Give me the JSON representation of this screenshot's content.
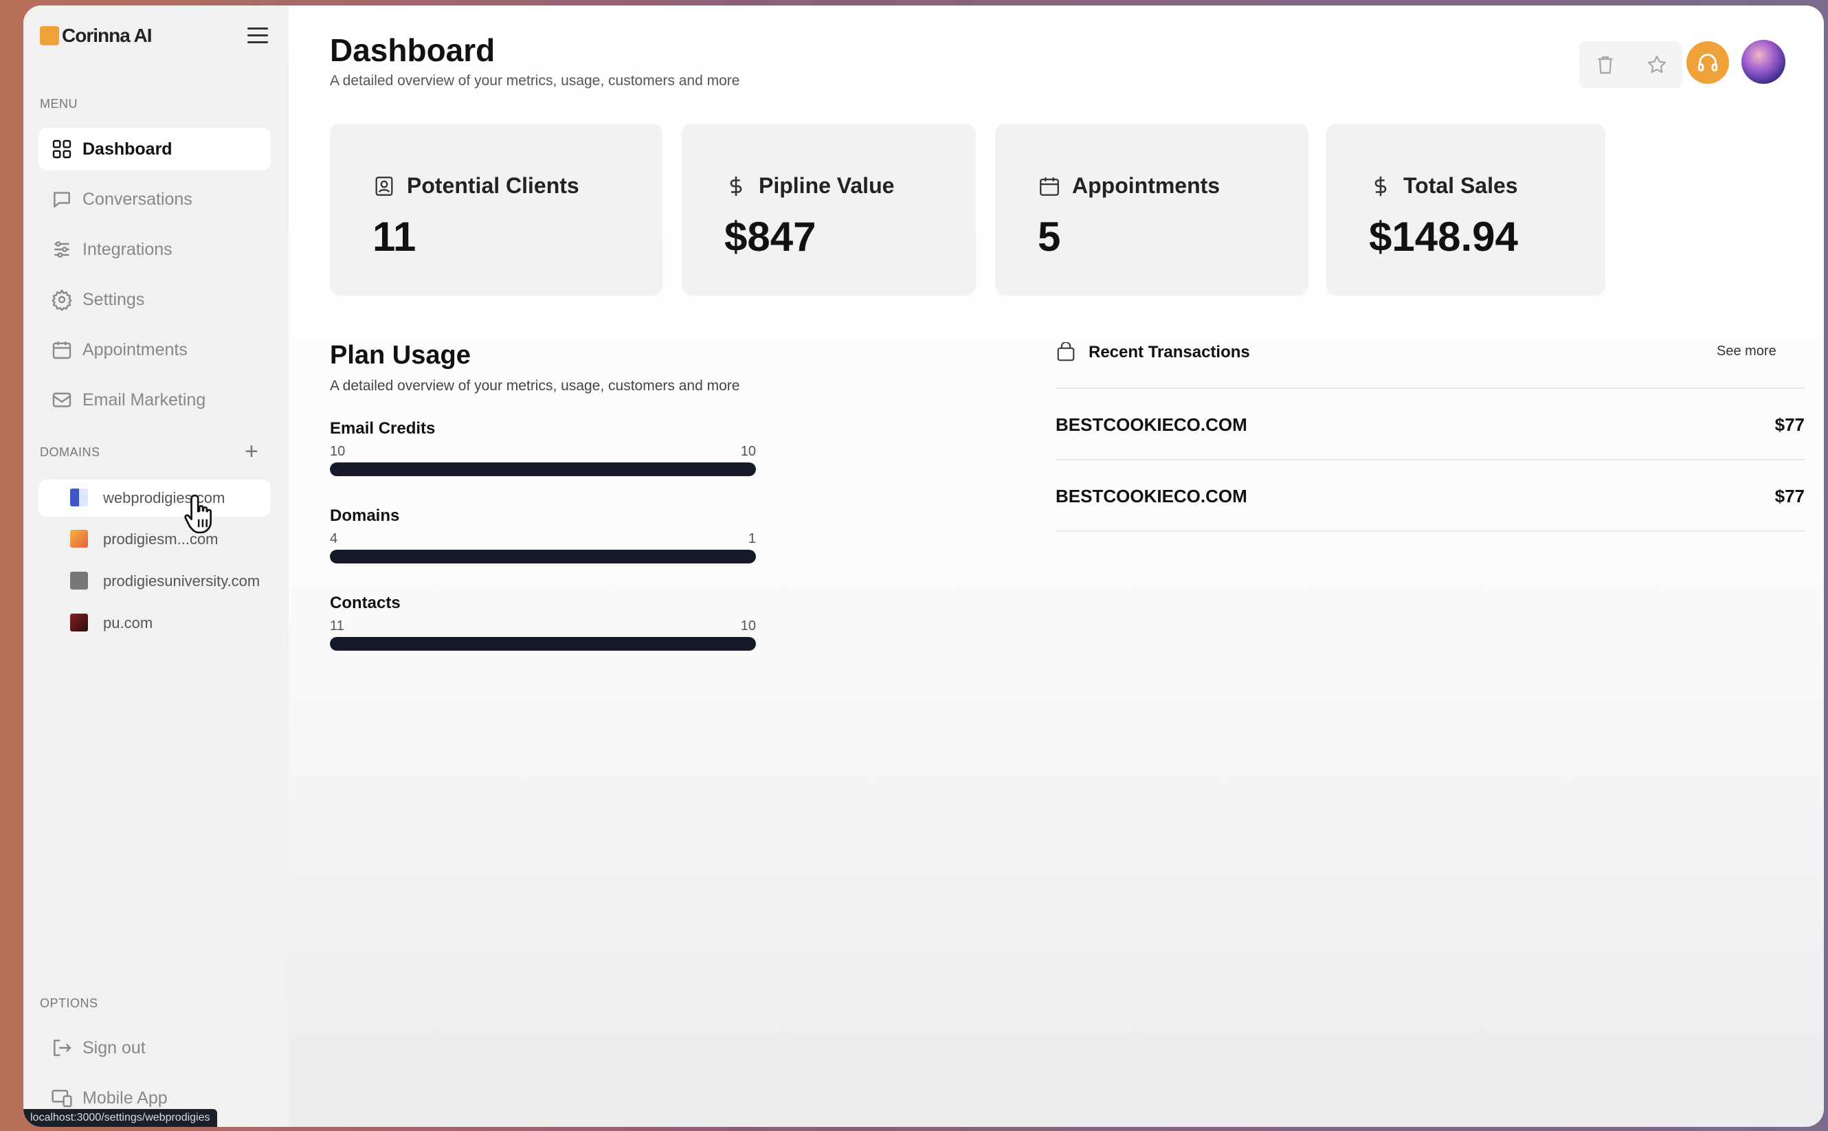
{
  "app": {
    "name": "Corinna AI",
    "accent_color": "#f0a23a"
  },
  "sidebar": {
    "menu_label": "MENU",
    "menu_items": [
      {
        "label": "Dashboard",
        "icon": "dashboard-grid-icon",
        "active": true
      },
      {
        "label": "Conversations",
        "icon": "chat-bubble-icon",
        "active": false
      },
      {
        "label": "Integrations",
        "icon": "sliders-icon",
        "active": false
      },
      {
        "label": "Settings",
        "icon": "gear-icon",
        "active": false
      },
      {
        "label": "Appointments",
        "icon": "calendar-icon",
        "active": false
      },
      {
        "label": "Email Marketing",
        "icon": "mail-icon",
        "active": false
      }
    ],
    "domains_label": "DOMAINS",
    "domains": [
      {
        "label": "webprodigies.com",
        "active": true
      },
      {
        "label": "prodigiesm...com"
      },
      {
        "label": "prodigiesuniversity.com"
      },
      {
        "label": "pu.com"
      }
    ],
    "options_label": "OPTIONS",
    "options": [
      {
        "label": "Sign out",
        "icon": "sign-out-icon"
      },
      {
        "label": "Mobile App",
        "icon": "devices-icon"
      }
    ]
  },
  "status_bar": {
    "url": "localhost:3000/settings/webprodigies"
  },
  "main": {
    "title": "Dashboard",
    "subtitle": "A detailed overview of your metrics, usage, customers and more"
  },
  "cards": [
    {
      "label": "Potential Clients",
      "value": "11",
      "icon": "person-badge-icon"
    },
    {
      "label": "Pipline Value",
      "value": "$847",
      "icon": "dollar-icon"
    },
    {
      "label": "Appointments",
      "value": "5",
      "icon": "calendar-icon"
    },
    {
      "label": "Total Sales",
      "value": "$148.94",
      "icon": "dollar-icon"
    }
  ],
  "plan_usage": {
    "title": "Plan Usage",
    "subtitle": "A detailed overview of your metrics, usage, customers and more",
    "items": [
      {
        "label": "Email Credits",
        "left": "10",
        "right": "10",
        "fill": 1.0
      },
      {
        "label": "Domains",
        "left": "4",
        "right": "1",
        "fill": 1.0
      },
      {
        "label": "Contacts",
        "left": "11",
        "right": "10",
        "fill": 1.0
      }
    ]
  },
  "transactions": {
    "title": "Recent Transactions",
    "see_more": "See more",
    "rows": [
      {
        "name": "BESTCOOKIECO.COM",
        "amount": "$77"
      },
      {
        "name": "BESTCOOKIECO.COM",
        "amount": "$77"
      }
    ]
  }
}
